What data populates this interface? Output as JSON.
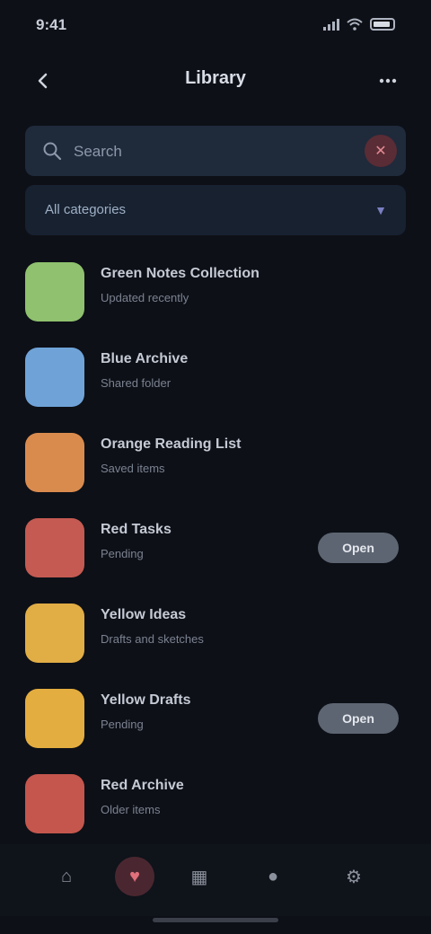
{
  "status_bar": {
    "time": "9:41"
  },
  "header": {
    "title": "Library",
    "back_icon": "chevron-left-icon",
    "menu_icon": "more-icon"
  },
  "search": {
    "placeholder": "Search",
    "value": ""
  },
  "filter": {
    "label": "All categories"
  },
  "list": {
    "items": [
      {
        "title": "Green Notes Collection",
        "subtitle": "Updated recently",
        "color": "#8fc16e",
        "action": ""
      },
      {
        "title": "Blue Archive",
        "subtitle": "Shared folder",
        "color": "#6fa3d8",
        "action": ""
      },
      {
        "title": "Orange Reading List",
        "subtitle": "Saved items",
        "color": "#d98b4e",
        "action": ""
      },
      {
        "title": "Red Tasks",
        "subtitle": "Pending",
        "color": "#c45a52",
        "action": "Open"
      },
      {
        "title": "Yellow Ideas",
        "subtitle": "Drafts and sketches",
        "color": "#e1ad45",
        "action": ""
      },
      {
        "title": "Yellow Drafts",
        "subtitle": "Pending",
        "color": "#e4ad3f",
        "action": "Open"
      },
      {
        "title": "Red Archive",
        "subtitle": "Older items",
        "color": "#c4564d",
        "action": ""
      }
    ]
  },
  "bottom_nav": {
    "items": [
      {
        "name": "home",
        "glyph": "⌂"
      },
      {
        "name": "favorites",
        "glyph": "♥"
      },
      {
        "name": "library",
        "glyph": "▦"
      },
      {
        "name": "profile",
        "glyph": "●"
      },
      {
        "name": "settings",
        "glyph": "⚙"
      }
    ],
    "active_index": 1
  }
}
